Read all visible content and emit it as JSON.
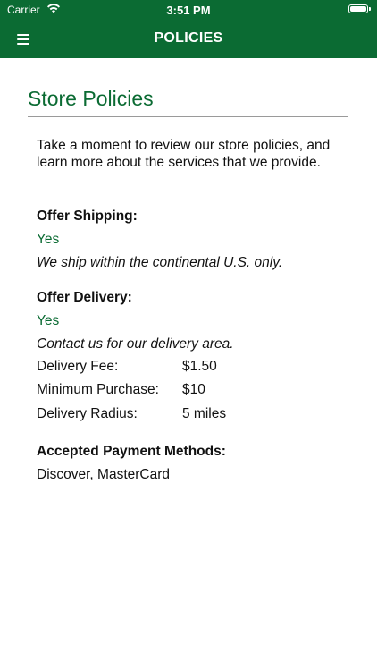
{
  "status_bar": {
    "carrier": "Carrier",
    "time": "3:51 PM"
  },
  "nav": {
    "title": "POLICIES"
  },
  "page": {
    "title": "Store Policies",
    "intro": "Take a moment to review our store policies, and learn more about the services that we provide."
  },
  "shipping": {
    "label": "Offer Shipping:",
    "value": "Yes",
    "note": "We ship within the continental U.S. only."
  },
  "delivery": {
    "label": "Offer Delivery:",
    "value": "Yes",
    "note": "Contact us for our delivery area.",
    "details": [
      {
        "key": "Delivery Fee:",
        "value": "$1.50"
      },
      {
        "key": "Minimum Purchase:",
        "value": "$10"
      },
      {
        "key": "Delivery Radius:",
        "value": "5 miles"
      }
    ]
  },
  "payment": {
    "label": "Accepted Payment Methods:",
    "value": "Discover, MasterCard"
  },
  "colors": {
    "brand": "#0b6b33"
  }
}
